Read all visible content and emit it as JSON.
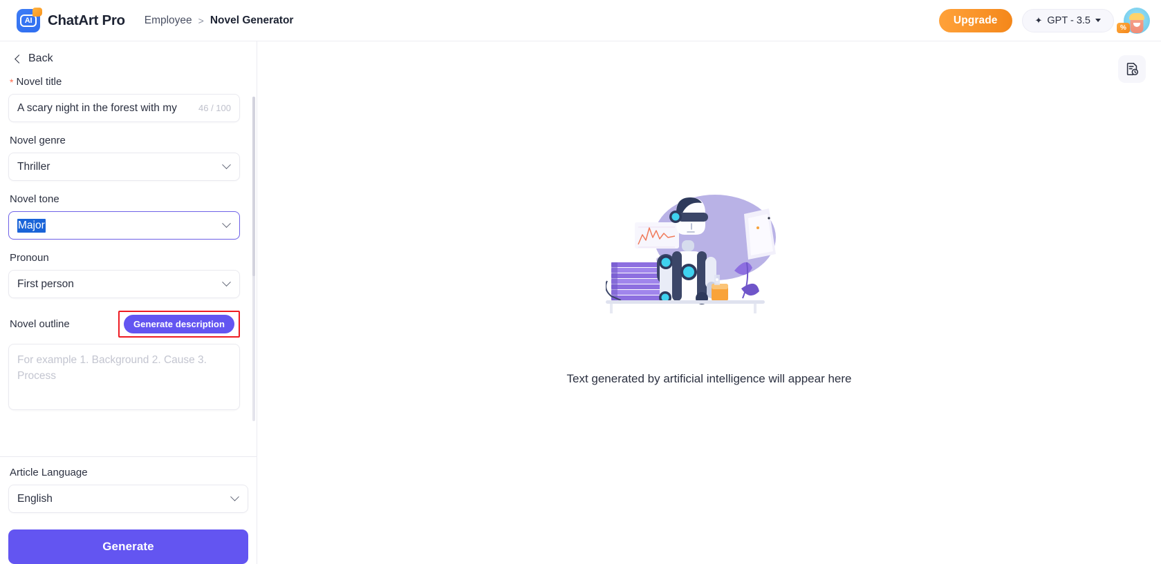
{
  "header": {
    "logo_icon": "chatart-ai-logo-icon",
    "logo_text": "AI",
    "brand_name": "ChatArt Pro",
    "breadcrumb": {
      "parent": "Employee",
      "separator": ">",
      "current": "Novel Generator"
    },
    "upgrade_label": "Upgrade",
    "model_selector": {
      "spark_icon": "sparkle-icon",
      "label": "GPT - 3.5",
      "caret_icon": "caret-down-icon"
    },
    "avatar": {
      "icon": "user-avatar",
      "badge": "%"
    }
  },
  "sidebar": {
    "back_label": "Back",
    "back_icon": "chevron-left-icon",
    "novel_title": {
      "label": "Novel title",
      "required_marker": "*",
      "value": "A scary night in the forest with my ",
      "char_count": "46 / 100"
    },
    "novel_genre": {
      "label": "Novel genre",
      "value": "Thriller",
      "chevron_icon": "chevron-down-icon"
    },
    "novel_tone": {
      "label": "Novel tone",
      "value": "Major",
      "chevron_icon": "chevron-down-icon",
      "focused": true,
      "text_selected": true
    },
    "pronoun": {
      "label": "Pronoun",
      "value": "First person",
      "chevron_icon": "chevron-down-icon"
    },
    "novel_outline": {
      "label": "Novel outline",
      "generate_description_label": "Generate description",
      "placeholder": "For example 1. Background 2. Cause 3. Process"
    },
    "article_language": {
      "label": "Article Language",
      "value": "English",
      "chevron_icon": "chevron-down-icon"
    },
    "generate_label": "Generate"
  },
  "main": {
    "history_icon": "document-clock-history-icon",
    "illustration": "ai-robot-scientist-illustration",
    "empty_text": "Text generated by artificial intelligence will appear here"
  },
  "colors": {
    "accent_purple": "#6355f1",
    "upgrade_orange": "#f4871a",
    "annotation_red": "#ee1b22",
    "selection_blue": "#1a64d8",
    "text_dark": "#2b3040",
    "placeholder_grey": "#c3c5d0"
  }
}
